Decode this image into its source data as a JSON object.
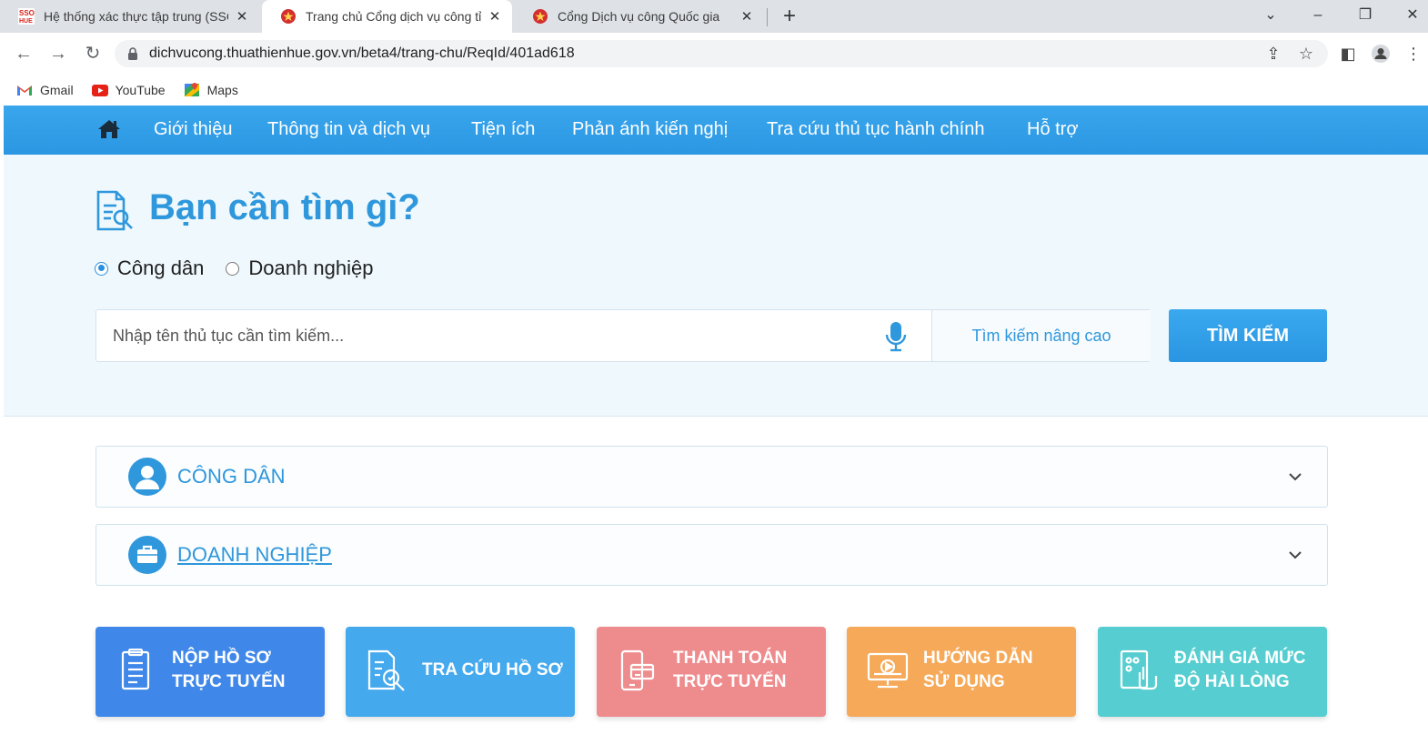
{
  "browser": {
    "tabs": [
      {
        "title": "Hệ thống xác thực tập trung (SSO",
        "active": false
      },
      {
        "title": "Trang chủ Cổng dịch vụ công tỉnh",
        "active": true
      },
      {
        "title": "Cổng Dịch vụ công Quốc gia",
        "active": false
      }
    ],
    "url": "dichvucong.thuathienhue.gov.vn/beta4/trang-chu/ReqId/401ad618",
    "bookmarks": [
      "Gmail",
      "YouTube",
      "Maps"
    ]
  },
  "nav": {
    "items": [
      "Giới thiệu",
      "Thông tin và dịch vụ",
      "Tiện ích",
      "Phản ánh kiến nghị",
      "Tra cứu thủ tục hành chính",
      "Hỗ trợ"
    ]
  },
  "search": {
    "title": "Bạn cần tìm gì?",
    "options": [
      "Công dân",
      "Doanh nghiệp"
    ],
    "selected": "Công dân",
    "placeholder": "Nhập tên thủ tục cần tìm kiếm...",
    "advanced_label": "Tìm kiếm nâng cao",
    "button_label": "TÌM KIẾM"
  },
  "sections": [
    {
      "label": "CÔNG DÂN"
    },
    {
      "label": "DOANH NGHIỆP"
    }
  ],
  "tiles": [
    {
      "line1": "NỘP HỒ SƠ",
      "line2": "TRỰC TUYẾN",
      "color": "#3f88ea"
    },
    {
      "line1": "TRA CỨU HỒ SƠ",
      "line2": "",
      "color": "#45a9ee"
    },
    {
      "line1": "THANH TOÁN",
      "line2": "TRỰC TUYẾN",
      "color": "#ee8b8d"
    },
    {
      "line1": "HƯỚNG DẪN",
      "line2": "SỬ DỤNG",
      "color": "#f6a958"
    },
    {
      "line1": "ĐÁNH GIÁ MỨC",
      "line2": "ĐỘ HÀI LÒNG",
      "color": "#56cdd0"
    }
  ]
}
